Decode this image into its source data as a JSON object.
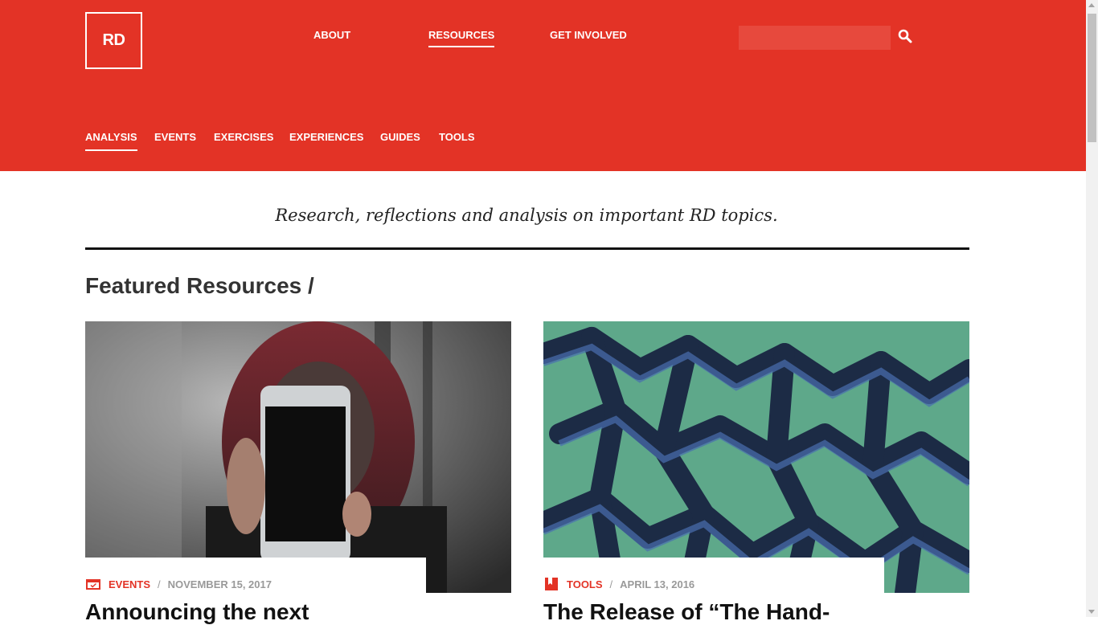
{
  "logo": {
    "text": "RD"
  },
  "main_nav": [
    {
      "label": "ABOUT",
      "active": false
    },
    {
      "label": "RESOURCES",
      "active": true
    },
    {
      "label": "GET INVOLVED",
      "active": false
    }
  ],
  "search": {
    "placeholder": "",
    "icon": "search-icon"
  },
  "sub_nav": [
    {
      "label": "ANALYSIS",
      "active": true
    },
    {
      "label": "EVENTS",
      "active": false
    },
    {
      "label": "EXERCISES",
      "active": false
    },
    {
      "label": "EXPERIENCES",
      "active": false
    },
    {
      "label": "GUIDES",
      "active": false
    },
    {
      "label": "TOOLS",
      "active": false
    }
  ],
  "tagline": "Research, reflections and analysis on important RD topics.",
  "section_title": "Featured Resources /",
  "cards": [
    {
      "category": "EVENTS",
      "category_icon": "calendar-icon",
      "separator": "/",
      "date": "NOVEMBER 15, 2017",
      "title": "Announcing the next"
    },
    {
      "category": "TOOLS",
      "category_icon": "bookmark-icon",
      "separator": "/",
      "date": "APRIL 13, 2016",
      "title": "The Release of “The Hand-"
    }
  ],
  "colors": {
    "brand_red": "#e33326",
    "text_dark": "#111111",
    "meta_gray": "#999999"
  }
}
